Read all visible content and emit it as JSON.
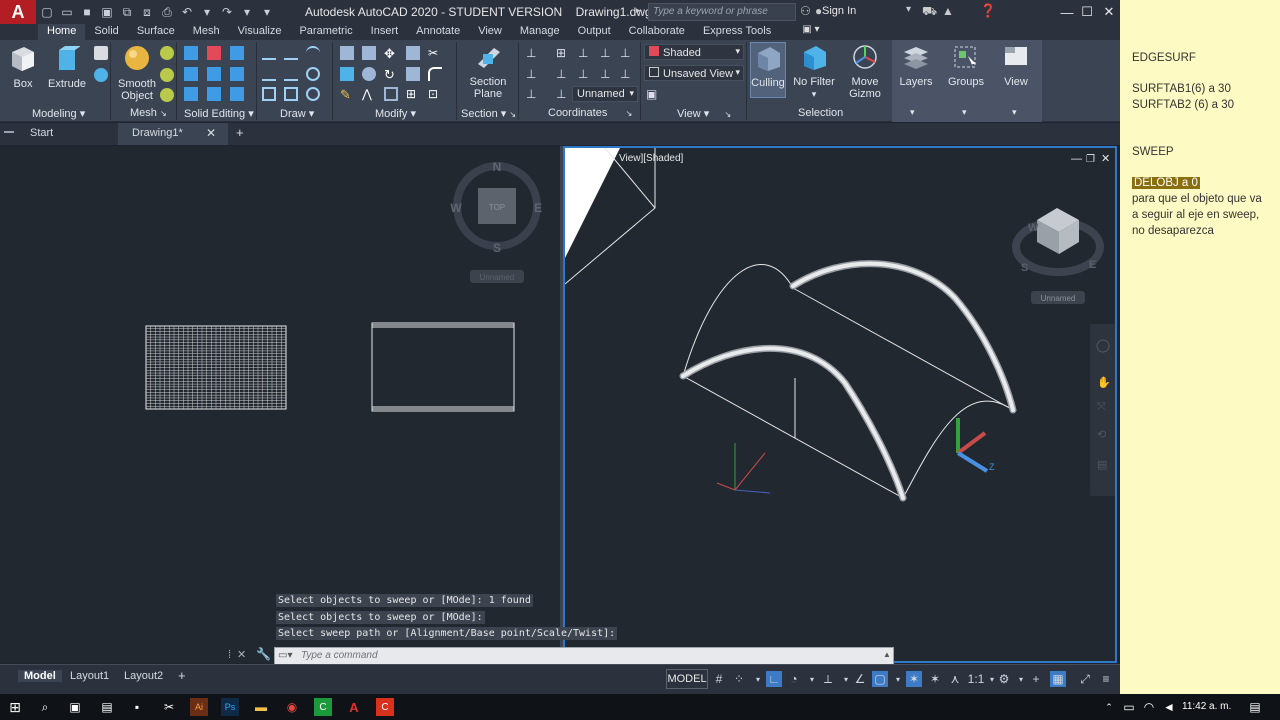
{
  "window": {
    "title": "Autodesk AutoCAD 2020 - STUDENT VERSION",
    "document": "Drawing1.dwg",
    "search_placeholder": "Type a keyword or phrase",
    "sign_in": "Sign In"
  },
  "app_logo_letter": "A",
  "ribbon_tabs": [
    "Home",
    "Solid",
    "Surface",
    "Mesh",
    "Visualize",
    "Parametric",
    "Insert",
    "Annotate",
    "View",
    "Manage",
    "Output",
    "Collaborate",
    "Express Tools"
  ],
  "ribbon": {
    "buttons": {
      "box": "Box",
      "extrude": "Extrude",
      "smooth_object_1": "Smooth",
      "smooth_object_2": "Object",
      "section_plane_1": "Section",
      "section_plane_2": "Plane",
      "culling": "Culling",
      "no_filter": "No Filter",
      "move_gizmo_1": "Move",
      "move_gizmo_2": "Gizmo",
      "layers": "Layers",
      "groups": "Groups",
      "view": "View"
    },
    "groups": {
      "modeling": "Modeling",
      "mesh": "Mesh",
      "solid_editing": "Solid Editing",
      "draw": "Draw",
      "modify": "Modify",
      "section": "Section",
      "coordinates": "Coordinates",
      "view": "View",
      "selection": "Selection"
    },
    "visual_style": "Shaded",
    "saved_view": "Unsaved View",
    "ucs_name": "Unnamed"
  },
  "doc_tabs": {
    "start": "Start",
    "drawing": "Drawing1*",
    "add": "+"
  },
  "viewports": {
    "left": {
      "compass": {
        "n": "N",
        "s": "S",
        "e": "E",
        "w": "W",
        "top": "TOP"
      },
      "ucs_label": "Unnamed"
    },
    "right": {
      "label": "View][Shaded]",
      "ucs_label": "Unnamed",
      "compass": {
        "w": "W",
        "s": "S",
        "e": "E"
      }
    }
  },
  "command": {
    "history": [
      "Select objects to sweep or [MOde]: 1 found",
      "Select objects to sweep or [MOde]:",
      "Select sweep path or [Alignment/Base point/Scale/Twist]:"
    ],
    "placeholder": "Type a command"
  },
  "status": {
    "layout_tabs": [
      "Model",
      "Layout1",
      "Layout2"
    ],
    "add_layout": "+",
    "space": "MODEL",
    "scale": "1:1"
  },
  "taskbar": {
    "time": "11:42 a. m."
  },
  "notes": {
    "line1": "EDGESURF",
    "line2": "SURFTAB1(6) a 30",
    "line3": "SURFTAB2 (6) a 30",
    "line4": "SWEEP",
    "highlight": "DELOBJ  a 0",
    "line5": "para que el objeto que va",
    "line6": "a seguir al eje en sweep,",
    "line7": "no desaparezca"
  },
  "colors": {
    "accent": "#2e78c7",
    "ribbon_bg": "#3b4453",
    "viewport_bg": "#212830",
    "notes_bg": "#fefac3",
    "logo_red": "#b31e24"
  }
}
